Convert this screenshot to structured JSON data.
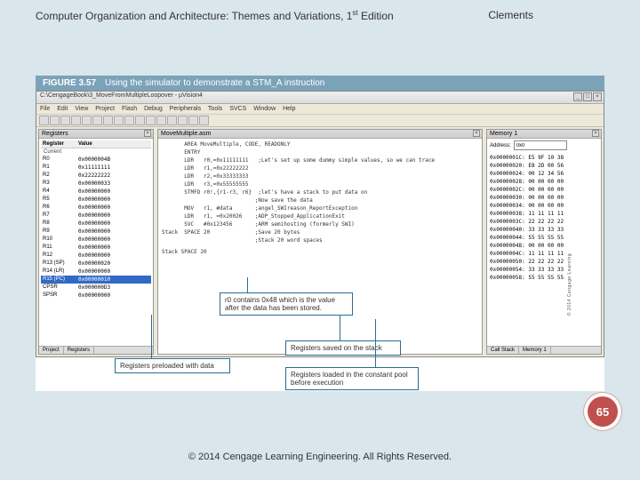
{
  "header": {
    "title_a": "Computer Organization and Architecture: Themes and Variations, 1",
    "title_sup": "st",
    "title_b": " Edition",
    "author": "Clements"
  },
  "figure": {
    "label": "FIGURE 3.57",
    "caption": "Using the simulator to demonstrate a STM_A instruction"
  },
  "app": {
    "title": "C:\\CengageBook\\3_MoveFromMultipleLoopover - µVision4",
    "menus": [
      "File",
      "Edit",
      "View",
      "Project",
      "Flash",
      "Debug",
      "Peripherals",
      "Tools",
      "SVCS",
      "Window",
      "Help"
    ]
  },
  "registers": {
    "title": "Registers",
    "hdr_name": "Register",
    "hdr_value": "Value",
    "group": "Current",
    "rows": [
      {
        "n": "R0",
        "v": "0x0000004B"
      },
      {
        "n": "R1",
        "v": "0x11111111"
      },
      {
        "n": "R2",
        "v": "0x22222222"
      },
      {
        "n": "R3",
        "v": "0x00000033"
      },
      {
        "n": "R4",
        "v": "0x00000000"
      },
      {
        "n": "R5",
        "v": "0x00000000"
      },
      {
        "n": "R6",
        "v": "0x00000000"
      },
      {
        "n": "R7",
        "v": "0x00000000"
      },
      {
        "n": "R8",
        "v": "0x00000000"
      },
      {
        "n": "R9",
        "v": "0x00000000"
      },
      {
        "n": "R10",
        "v": "0x00000000"
      },
      {
        "n": "R11",
        "v": "0x00000000"
      },
      {
        "n": "R12",
        "v": "0x00000000"
      },
      {
        "n": "R13 (SP)",
        "v": "0x00000020"
      },
      {
        "n": "R14 (LR)",
        "v": "0x00000000"
      },
      {
        "n": "R15 (PC)",
        "v": "0x00000010",
        "sel": true
      }
    ],
    "psr_rows": [
      {
        "n": "CPSR",
        "v": "0x000000D3"
      },
      {
        "n": "SPSR",
        "v": "0x00000000"
      }
    ],
    "tabs": [
      "Project",
      "Registers"
    ]
  },
  "code": {
    "title": "MoveMultiple.asm",
    "lines": [
      "       AREA MoveMultiple, CODE, READONLY",
      "       ENTRY",
      "       LDR   r0,=0x11111111   ;Let's set up some dummy simple values, so we can trace",
      "       LDR   r1,=0x22222222",
      "       LDR   r2,=0x33333333",
      "       LDR   r3,=0x55555555",
      "       STMFD r0!,{r1-r3, r6}  ;let's have a stack to put data on",
      "                             ;Now save the data",
      "       MOV   r1, #data       ;angel_SWIreason_ReportException",
      "       LDR   r1, =0x20026    ;ADP_Stopped_ApplicationExit",
      "       SVC   #0x123456       ;ARM semihosting (formerly SWI)",
      "Stack  SPACE 20              ;Save 20 bytes",
      "                             ;Stack 20 word spaces"
    ],
    "sub": "Stack SPACE 20"
  },
  "memory": {
    "title": "Memory 1",
    "addr_label": "Address:",
    "addr_value": "0x0",
    "rows": [
      "0x0000001C: E5 9F 10 38",
      "0x00000020: E8 2D 00 56",
      "0x00000024: 00 12 34 56",
      "0x00000028: 00 00 00 00",
      "0x0000002C: 00 00 00 00",
      "0x00000030: 00 00 00 00",
      "0x00000034: 00 00 00 00",
      "0x00000038: 11 11 11 11",
      "0x0000003C: 22 22 22 22",
      "0x00000040: 33 33 33 33",
      "0x00000044: 55 55 55 55",
      "0x00000048: 00 00 00 00",
      "0x0000004C: 11 11 11 11",
      "0x00000050: 22 22 22 22",
      "0x00000054: 33 33 33 33",
      "0x00000058: 55 55 55 55"
    ],
    "tabs": [
      "Call Stack",
      "Memory 1"
    ]
  },
  "callouts": {
    "c1": "r0 contains 0x48 which is the value after the data has been stored.",
    "c2": "Registers preloaded with data",
    "c3": "Registers saved on the stack",
    "c4": "Registers loaded in the constant pool before execution"
  },
  "page_number": "65",
  "footer": "© 2014 Cengage Learning Engineering. All Rights Reserved.",
  "side_credit": "© 2014 Cengage Learning"
}
